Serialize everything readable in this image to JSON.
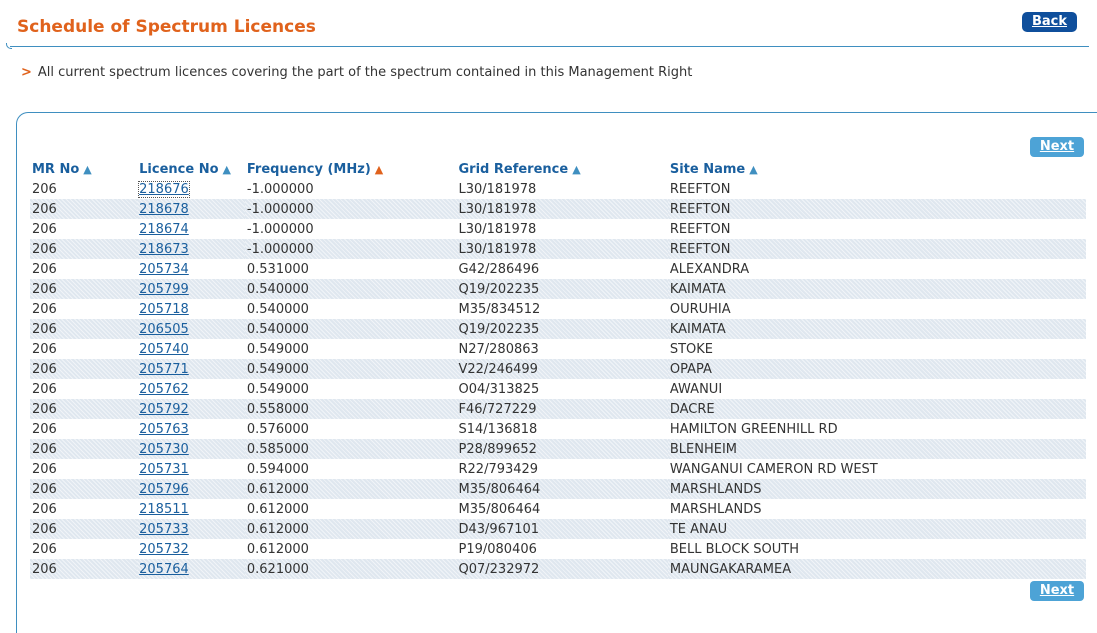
{
  "header": {
    "title": "Schedule of Spectrum Licences",
    "back_label": "Back",
    "accent_color": "#e0621c",
    "link_color": "#1a5f9e"
  },
  "intro": {
    "arrow": ">",
    "text": "All current spectrum licences covering the part of the spectrum contained in this Management Right"
  },
  "pagination": {
    "next_label": "Next"
  },
  "table": {
    "columns": [
      "MR No",
      "Licence No",
      "Frequency (MHz)",
      "Grid Reference",
      "Site Name"
    ],
    "sort_icons": [
      "sort-asc-icon",
      "sort-asc-icon",
      "sort-active-icon",
      "sort-asc-icon",
      "sort-asc-icon"
    ],
    "rows": [
      {
        "mr": "206",
        "licence": "218676",
        "freq": "-1.000000",
        "grid": "L30/181978",
        "site": "REEFTON"
      },
      {
        "mr": "206",
        "licence": "218678",
        "freq": "-1.000000",
        "grid": "L30/181978",
        "site": "REEFTON"
      },
      {
        "mr": "206",
        "licence": "218674",
        "freq": "-1.000000",
        "grid": "L30/181978",
        "site": "REEFTON"
      },
      {
        "mr": "206",
        "licence": "218673",
        "freq": "-1.000000",
        "grid": "L30/181978",
        "site": "REEFTON"
      },
      {
        "mr": "206",
        "licence": "205734",
        "freq": "0.531000",
        "grid": "G42/286496",
        "site": "ALEXANDRA"
      },
      {
        "mr": "206",
        "licence": "205799",
        "freq": "0.540000",
        "grid": "Q19/202235",
        "site": "KAIMATA"
      },
      {
        "mr": "206",
        "licence": "205718",
        "freq": "0.540000",
        "grid": "M35/834512",
        "site": "OURUHIA"
      },
      {
        "mr": "206",
        "licence": "206505",
        "freq": "0.540000",
        "grid": "Q19/202235",
        "site": "KAIMATA"
      },
      {
        "mr": "206",
        "licence": "205740",
        "freq": "0.549000",
        "grid": "N27/280863",
        "site": "STOKE"
      },
      {
        "mr": "206",
        "licence": "205771",
        "freq": "0.549000",
        "grid": "V22/246499",
        "site": "OPAPA"
      },
      {
        "mr": "206",
        "licence": "205762",
        "freq": "0.549000",
        "grid": "O04/313825",
        "site": "AWANUI"
      },
      {
        "mr": "206",
        "licence": "205792",
        "freq": "0.558000",
        "grid": "F46/727229",
        "site": "DACRE"
      },
      {
        "mr": "206",
        "licence": "205763",
        "freq": "0.576000",
        "grid": "S14/136818",
        "site": "HAMILTON GREENHILL RD"
      },
      {
        "mr": "206",
        "licence": "205730",
        "freq": "0.585000",
        "grid": "P28/899652",
        "site": "BLENHEIM"
      },
      {
        "mr": "206",
        "licence": "205731",
        "freq": "0.594000",
        "grid": "R22/793429",
        "site": "WANGANUI CAMERON RD WEST"
      },
      {
        "mr": "206",
        "licence": "205796",
        "freq": "0.612000",
        "grid": "M35/806464",
        "site": "MARSHLANDS"
      },
      {
        "mr": "206",
        "licence": "218511",
        "freq": "0.612000",
        "grid": "M35/806464",
        "site": "MARSHLANDS"
      },
      {
        "mr": "206",
        "licence": "205733",
        "freq": "0.612000",
        "grid": "D43/967101",
        "site": "TE ANAU"
      },
      {
        "mr": "206",
        "licence": "205732",
        "freq": "0.612000",
        "grid": "P19/080406",
        "site": "BELL BLOCK SOUTH"
      },
      {
        "mr": "206",
        "licence": "205764",
        "freq": "0.621000",
        "grid": "Q07/232972",
        "site": "MAUNGAKARAMEA"
      }
    ]
  }
}
